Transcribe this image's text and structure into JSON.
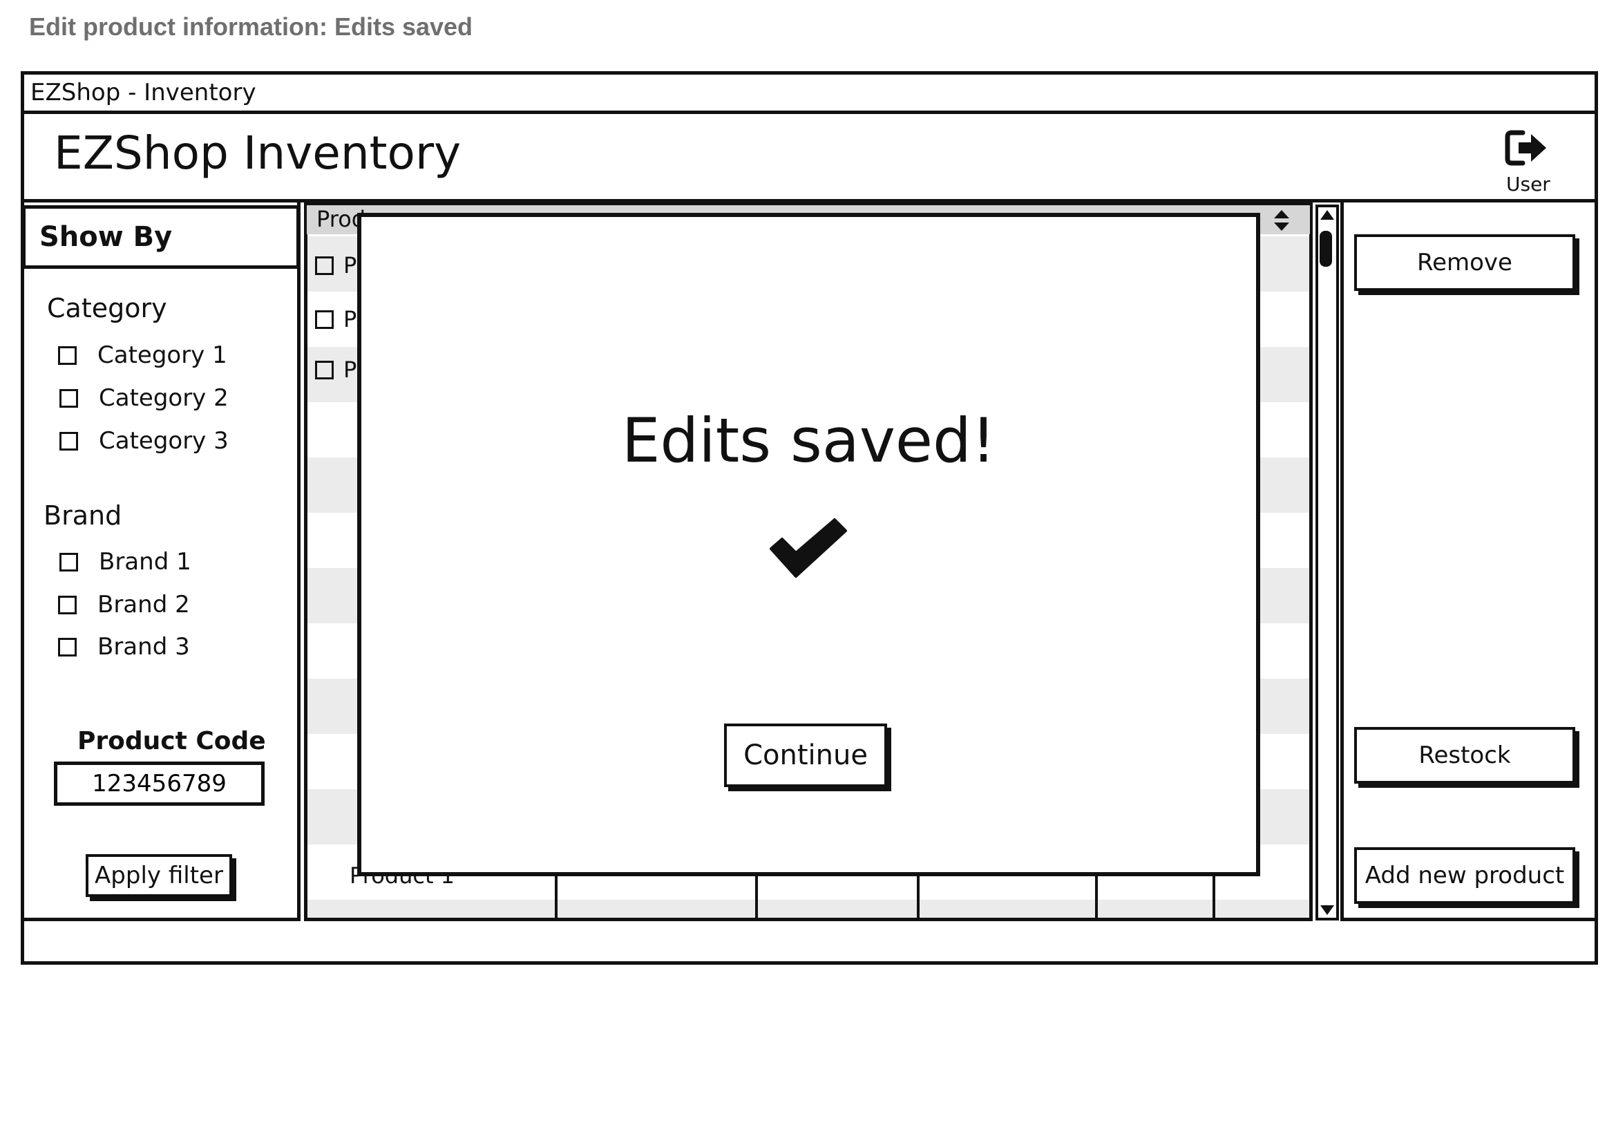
{
  "caption": "Edit product information: Edits saved",
  "window": {
    "title": "EZShop - Inventory"
  },
  "header": {
    "title": "EZShop Inventory",
    "user_label": "User",
    "user_icon": "sign-out-icon"
  },
  "sidebar": {
    "show_by": "Show By",
    "category": {
      "title": "Category",
      "items": [
        "Category 1",
        "Category 2",
        "Category 3"
      ]
    },
    "brand": {
      "title": "Brand",
      "items": [
        "Brand 1",
        "Brand 2",
        "Brand 3"
      ]
    },
    "product_code": {
      "label": "Product Code",
      "value": "123456789"
    },
    "apply_label": "Apply filter"
  },
  "table": {
    "header_visible": "Prod",
    "row_prefixes": [
      "P",
      "P",
      "P"
    ],
    "last_row_visible": "Product 1"
  },
  "actions": {
    "remove": "Remove",
    "restock": "Restock",
    "add": "Add new product"
  },
  "modal": {
    "title": "Edits saved!",
    "icon": "checkmark-icon",
    "button": "Continue"
  }
}
